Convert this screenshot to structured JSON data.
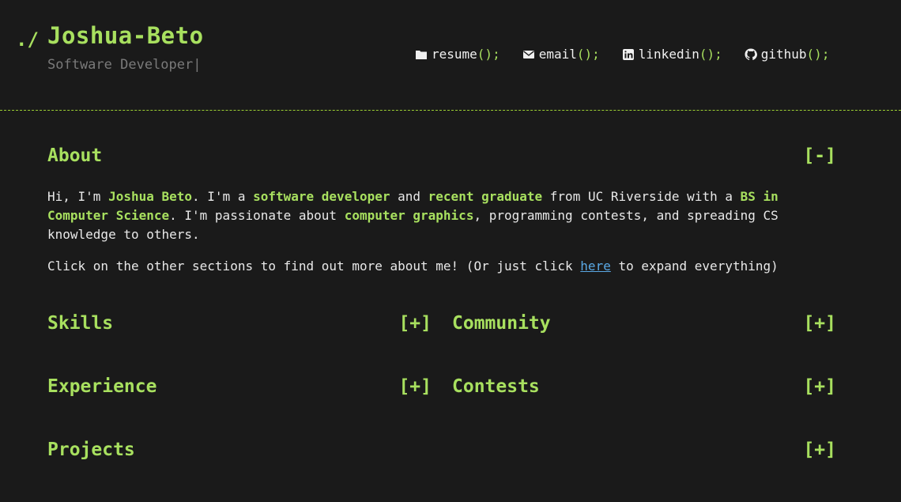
{
  "header": {
    "prompt": "./",
    "name": "Joshua-Beto",
    "subtitle": "Software Developer",
    "cursor": "|"
  },
  "nav": [
    {
      "label": "resume",
      "parens": "();",
      "icon": "folder-icon"
    },
    {
      "label": "email",
      "parens": "();",
      "icon": "envelope-icon"
    },
    {
      "label": "linkedin",
      "parens": "();",
      "icon": "linkedin-icon"
    },
    {
      "label": "github",
      "parens": "();",
      "icon": "github-icon"
    }
  ],
  "about": {
    "title": "About",
    "toggle": "[-]",
    "p1": {
      "t1": "Hi, I'm ",
      "h1": "Joshua Beto",
      "t2": ". I'm a ",
      "h2": "software developer",
      "t3": " and ",
      "h3": "recent graduate",
      "t4": " from UC Riverside with a ",
      "h4": "BS in Computer Science",
      "t5": ". I'm passionate about ",
      "h5": "computer graphics",
      "t6": ", programming contests, and spreading CS knowledge to others."
    },
    "p2": {
      "t1": "Click on the other sections to find out more about me! (Or just click ",
      "link": "here",
      "t2": " to expand everything)"
    }
  },
  "sections": {
    "skills": {
      "title": "Skills",
      "toggle": "[+]"
    },
    "community": {
      "title": "Community",
      "toggle": "[+]"
    },
    "experience": {
      "title": "Experience",
      "toggle": "[+]"
    },
    "contests": {
      "title": "Contests",
      "toggle": "[+]"
    },
    "projects": {
      "title": "Projects",
      "toggle": "[+]"
    }
  },
  "colors": {
    "background": "#1a1a1a",
    "accent": "#a8e05f",
    "link": "#5aa9e6",
    "muted": "#7a7a7a"
  }
}
